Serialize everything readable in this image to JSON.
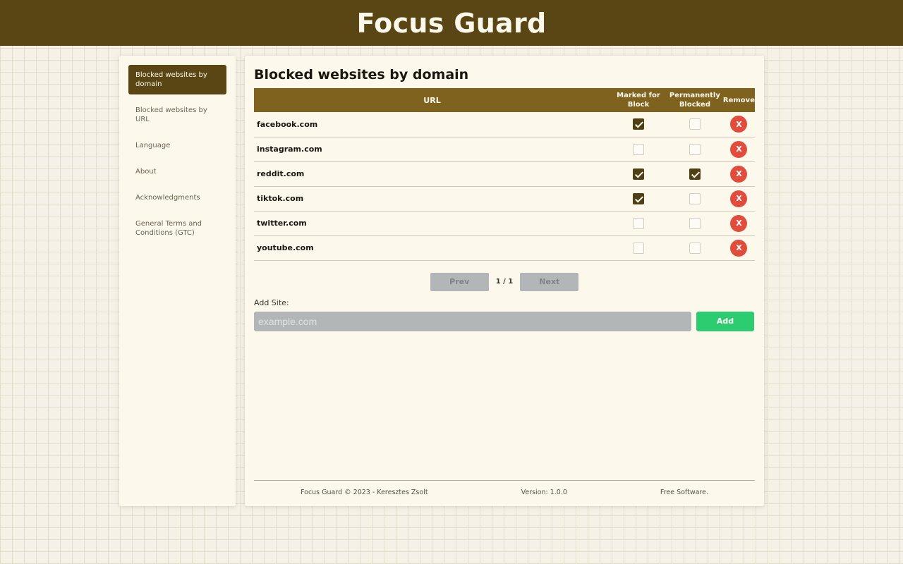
{
  "app": {
    "title": "Focus Guard"
  },
  "sidebar": {
    "items": [
      {
        "label": "Blocked websites by domain",
        "active": true
      },
      {
        "label": "Blocked websites by URL",
        "active": false
      },
      {
        "label": "Language",
        "active": false
      },
      {
        "label": "About",
        "active": false
      },
      {
        "label": "Acknowledgments",
        "active": false
      },
      {
        "label": "General Terms and Conditions (GTC)",
        "active": false
      }
    ]
  },
  "main": {
    "title": "Blocked websites by domain",
    "table": {
      "headers": {
        "url": "URL",
        "marked": "Marked for Block",
        "permanent": "Permanently Blocked",
        "remove": "Remove"
      },
      "remove_label": "X",
      "rows": [
        {
          "domain": "facebook.com",
          "marked": true,
          "permanent": false
        },
        {
          "domain": "instagram.com",
          "marked": false,
          "permanent": false
        },
        {
          "domain": "reddit.com",
          "marked": true,
          "permanent": true
        },
        {
          "domain": "tiktok.com",
          "marked": true,
          "permanent": false
        },
        {
          "domain": "twitter.com",
          "marked": false,
          "permanent": false
        },
        {
          "domain": "youtube.com",
          "marked": false,
          "permanent": false
        }
      ]
    },
    "pagination": {
      "prev": "Prev",
      "next": "Next",
      "info": "1 / 1"
    },
    "add": {
      "label": "Add Site:",
      "placeholder": "example.com",
      "value": "",
      "button": "Add"
    }
  },
  "footer": {
    "copyright": "Focus Guard © 2023 - Keresztes Zsolt",
    "version": "Version: 1.0.0",
    "license": "Free Software."
  },
  "colors": {
    "brand": "#5a4614",
    "table_header": "#7f621e",
    "remove": "#e14c3d",
    "add": "#2ecc71"
  }
}
